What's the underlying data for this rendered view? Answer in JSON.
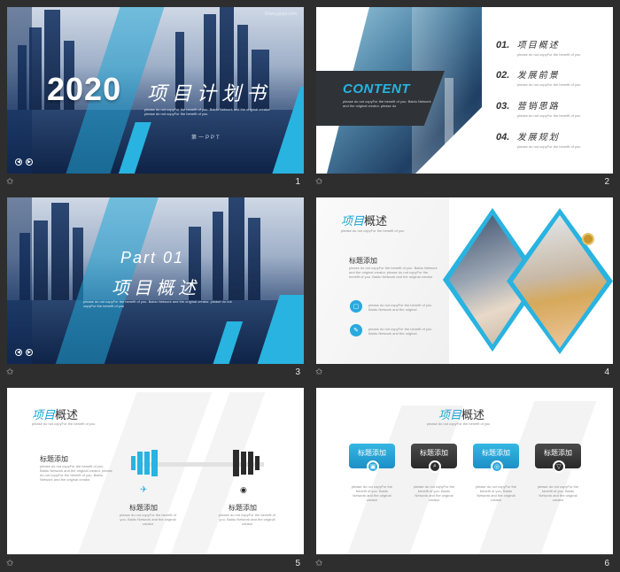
{
  "colors": {
    "accent": "#1aa7d6",
    "dark": "#333333",
    "bg": "#2e2e2e"
  },
  "slides": [
    {
      "number": "1",
      "watermark": "Www.ypppt.com",
      "year": "2020",
      "title": "项目计划书",
      "body": "please do not copyFor the benefit of you. Baidu Network and the original creator. please do not copyFor the benefit of you",
      "sub": "第一PPT"
    },
    {
      "number": "2",
      "content": "CONTENT",
      "body": "please do not copyFor the benefit of you. Baidu Network and the original creator. please do",
      "items": [
        {
          "n": "01.",
          "t": "项目概述",
          "d": "please do not copyFor the benefit of you"
        },
        {
          "n": "02.",
          "t": "发展前景",
          "d": "please do not copyFor the benefit of you"
        },
        {
          "n": "03.",
          "t": "营销思路",
          "d": "please do not copyFor the benefit of you"
        },
        {
          "n": "04.",
          "t": "发展规划",
          "d": "please do not copyFor the benefit of you"
        }
      ]
    },
    {
      "number": "3",
      "part": "Part 01",
      "title": "项目概述",
      "body": "please do not copyFor the benefit of you. Baidu Network and the original creator. please do not copyFor the benefit of you"
    },
    {
      "number": "4",
      "title_a": "项目",
      "title_b": "概述",
      "sub": "please do not copyFor the benefit of you",
      "h": "标题添加",
      "body": "please do not copyFor the benefit of you. Baidu Network and the original creator. please do not copyFor the benefit of you. Baidu Network and the original creator",
      "p1": "please do not copyFor the benefit of you. Baidu Network and the original",
      "p2": "please do not copyFor the benefit of you. Baidu Network and the original"
    },
    {
      "number": "5",
      "title_a": "项目",
      "title_b": "概述",
      "sub": "please do not copyFor the benefit of you",
      "h1": "标题添加",
      "b1": "please do not copyFor the benefit of you. Baidu Network and the original creator. please do not copyFor the benefit of you. Baidu Network and the original creator",
      "h2": "标题添加",
      "b2": "please do not copyFor the benefit of you. Baidu Network and the original creator",
      "h3": "标题添加",
      "b3": "please do not copyFor the benefit of you. Baidu Network and the original creator"
    },
    {
      "number": "6",
      "title_a": "项目",
      "title_b": "概述",
      "sub": "please do not copyFor the benefit of you",
      "cards": [
        {
          "h": "标题添加",
          "b": "please do not copyFor the benefit of you. Baidu Network and the original creator"
        },
        {
          "h": "标题添加",
          "b": "please do not copyFor the benefit of you. Baidu Network and the original creator"
        },
        {
          "h": "标题添加",
          "b": "please do not copyFor the benefit of you. Baidu Network and the original creator"
        },
        {
          "h": "标题添加",
          "b": "please do not copyFor the benefit of you. Baidu Network and the original creator"
        }
      ]
    }
  ]
}
